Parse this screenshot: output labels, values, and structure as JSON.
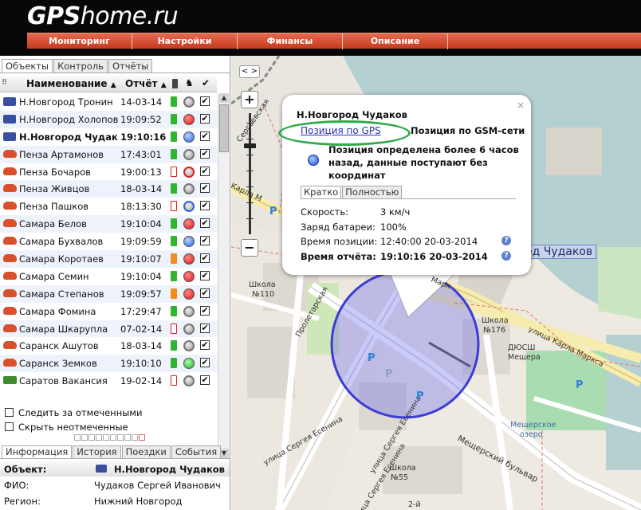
{
  "header": {
    "logo_bold": "GPS",
    "logo_rest": "home.ru",
    "menu": [
      {
        "label": "Мониторинг"
      },
      {
        "label": "Настройки"
      },
      {
        "label": "Финансы"
      },
      {
        "label": "Описание"
      }
    ]
  },
  "left": {
    "tabs": [
      {
        "label": "Объекты"
      },
      {
        "label": "Контроль"
      },
      {
        "label": "Отчёты"
      }
    ],
    "columns": {
      "name": "Наименование",
      "report": "Отчёт",
      "sort_arrow": "▲",
      "check": "✔"
    },
    "rows": [
      {
        "vehicle": "moto",
        "name": "Н.Новгород Тронин",
        "time": "14-03-14",
        "battery": "green",
        "status": "grey",
        "checked": "✔",
        "bold": false
      },
      {
        "vehicle": "moto",
        "name": "Н.Новгород Холопов",
        "time": "19:09:52",
        "battery": "green",
        "status": "red",
        "checked": "✔",
        "bold": false
      },
      {
        "vehicle": "moto",
        "name": "Н.Новгород Чудаков",
        "time": "19:10:16",
        "battery": "green",
        "status": "blue",
        "checked": "✔",
        "bold": true
      },
      {
        "vehicle": "car",
        "name": "Пенза Артамонов",
        "time": "17:43:01",
        "battery": "green",
        "status": "grey",
        "checked": "✔",
        "bold": false
      },
      {
        "vehicle": "car",
        "name": "Пенза Бочаров",
        "time": "19:00:13",
        "battery": "red",
        "status": "grey-red",
        "checked": "✔",
        "bold": false
      },
      {
        "vehicle": "car",
        "name": "Пенза Живцов",
        "time": "18-03-14",
        "battery": "green",
        "status": "grey",
        "checked": "✔",
        "bold": false
      },
      {
        "vehicle": "car",
        "name": "Пенза Пашков",
        "time": "18:13:30",
        "battery": "red",
        "status": "grey-blue",
        "checked": "✔",
        "bold": false
      },
      {
        "vehicle": "car",
        "name": "Самара Белов",
        "time": "19:10:04",
        "battery": "green",
        "status": "red",
        "checked": "✔",
        "bold": false
      },
      {
        "vehicle": "car",
        "name": "Самара Бухвалов",
        "time": "19:09:59",
        "battery": "green",
        "status": "blue",
        "checked": "✔",
        "bold": false
      },
      {
        "vehicle": "car",
        "name": "Самара Коротаев",
        "time": "19:10:07",
        "battery": "orange",
        "status": "red",
        "checked": "✔",
        "bold": false
      },
      {
        "vehicle": "car",
        "name": "Самара Семин",
        "time": "19:10:04",
        "battery": "green",
        "status": "red",
        "checked": "✔",
        "bold": false
      },
      {
        "vehicle": "car",
        "name": "Самара Степанов",
        "time": "19:09:57",
        "battery": "orange",
        "status": "red",
        "checked": "✔",
        "bold": false
      },
      {
        "vehicle": "car",
        "name": "Самара Фомина",
        "time": "17:29:47",
        "battery": "green",
        "status": "grey",
        "checked": "✔",
        "bold": false
      },
      {
        "vehicle": "car",
        "name": "Самара Шкарупла",
        "time": "07-02-14",
        "battery": "red",
        "status": "grey",
        "checked": "✔",
        "bold": false
      },
      {
        "vehicle": "car",
        "name": "Саранск Ашутов",
        "time": "18-03-14",
        "battery": "green",
        "status": "grey",
        "checked": "✔",
        "bold": false
      },
      {
        "vehicle": "car",
        "name": "Саранск Земков",
        "time": "19:10:10",
        "battery": "green",
        "status": "green",
        "checked": "✔",
        "bold": false
      },
      {
        "vehicle": "truck",
        "name": "Саратов Вакансия",
        "time": "19-02-14",
        "battery": "red",
        "status": "grey",
        "checked": "✔",
        "bold": false
      }
    ],
    "options": {
      "follow": "Следить за отмеченными",
      "hide": "Скрыть неотмеченные"
    },
    "info_tabs": [
      {
        "label": "Информация"
      },
      {
        "label": "История"
      },
      {
        "label": "Поездки"
      },
      {
        "label": "События"
      }
    ],
    "info": {
      "object_label": "Объект:",
      "object_value": "Н.Новгород Чудаков",
      "fio_label": "ФИО:",
      "fio_value": "Чудаков Сергей Иванович",
      "region_label": "Регион:",
      "region_value": "Нижний Новгород"
    }
  },
  "map": {
    "toggle": "< >",
    "zoom_in": "+",
    "zoom_out": "−",
    "object_label": "од Чудаков",
    "labels": {
      "school110_a": "Школа",
      "school110_b": "№110",
      "school176_a": "Школа",
      "school176_b": "№176",
      "school55_a": "Школа",
      "school55_b": "№55",
      "dyush_a": "ДЮСШ",
      "dyush_b": "Мещера",
      "lake_a": "Мещерское",
      "lake_b": "озеро",
      "karla_marksa": "улица Карла Маркса",
      "karla_short": "Карла М",
      "proletarskaya": "Пролетарская",
      "eseninas_a": "улица Сергея Есенина",
      "eseninas_b": "улица Сергея Есенина",
      "eseninas_c": "улица Сергея Есенина",
      "meshchersky": "Мещерский бульвар",
      "marks": "Марк",
      "street_2": "2-й",
      "sertgeevskaya": "Сергеевская"
    },
    "parking": "P"
  },
  "popup": {
    "close": "×",
    "title": "Н.Новгород Чудаков",
    "gps_link": "Позиция по GPS",
    "gsm_label": "Позиция по GSM-сети",
    "warning": "Позиция определена более 6 часов назад, данные поступают без координат",
    "tabs": [
      {
        "label": "Кратко"
      },
      {
        "label": "Полностью"
      }
    ],
    "speed_label": "Скорость:",
    "speed_value": "3 км/ч",
    "battery_label": "Заряд батареи:",
    "battery_value": "100%",
    "pos_time_label": "Время позиции:",
    "pos_time_value": "12:40:00 20-03-2014",
    "report_time_label": "Время отчёта:",
    "report_time_value": "19:10:16 20-03-2014",
    "help": "?"
  },
  "colors": {
    "menu_red": "#d4482c",
    "header_black": "#070707",
    "link_blue": "#2a33b0",
    "gps_ring_green": "#2fab4a",
    "accuracy_circle": "#3b3bd6"
  }
}
